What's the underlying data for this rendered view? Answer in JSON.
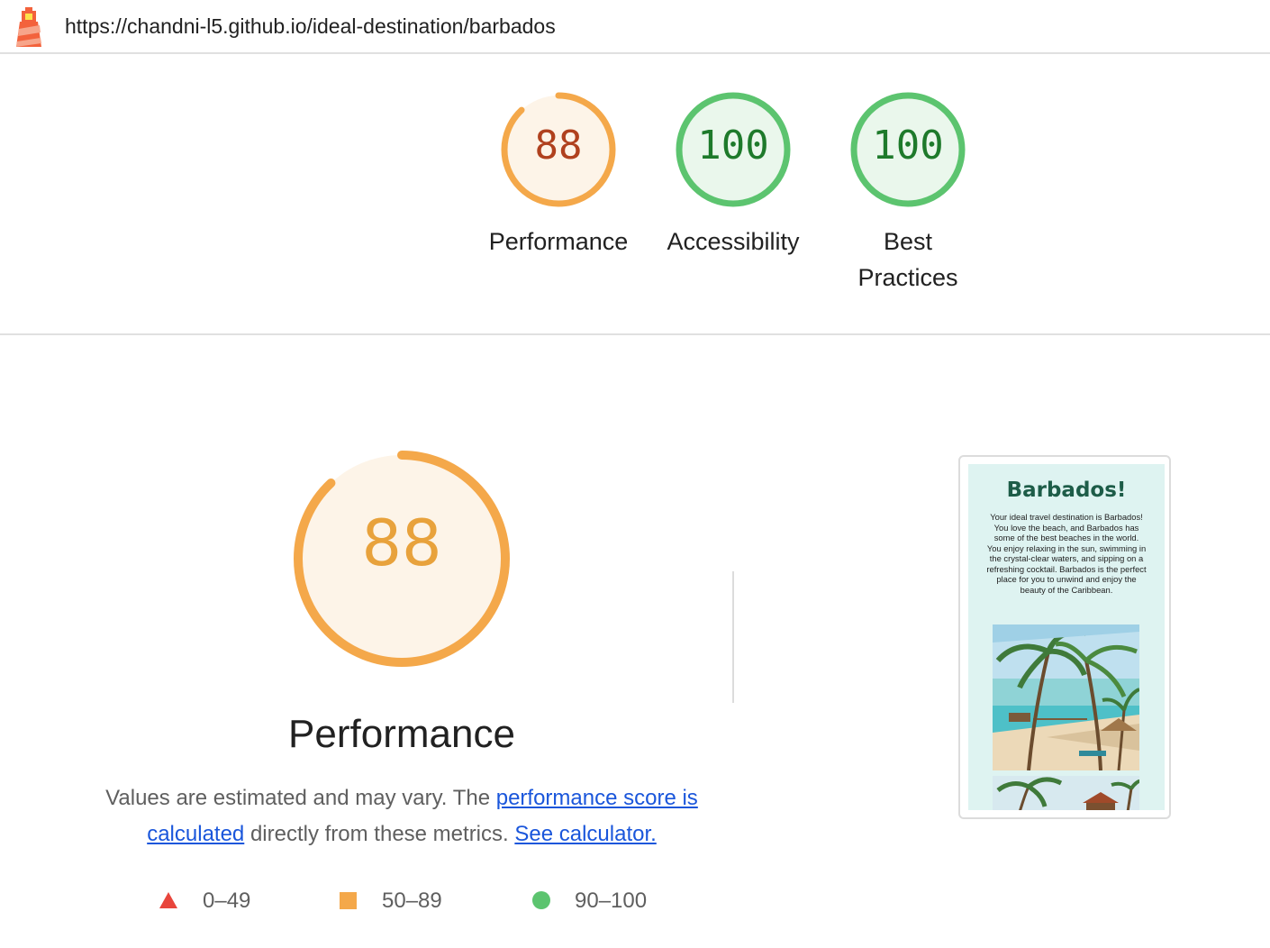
{
  "header": {
    "url": "https://chandni-l5.github.io/ideal-destination/barbados",
    "logo_icon": "lighthouse-icon"
  },
  "summary_gauges": [
    {
      "label": "Performance",
      "score": "88",
      "score_value": 88,
      "rating": "average"
    },
    {
      "label": "Accessibility",
      "score": "100",
      "score_value": 100,
      "rating": "pass"
    },
    {
      "label_line1": "Best",
      "label_line2": "Practices",
      "score": "100",
      "score_value": 100,
      "rating": "pass"
    }
  ],
  "performance": {
    "score": "88",
    "score_value": 88,
    "title": "Performance",
    "description_prefix": "Values are estimated and may vary. The ",
    "link_score": "performance score is calculated",
    "description_mid": " directly from these metrics. ",
    "link_calculator": "See calculator."
  },
  "legend": [
    {
      "range": "0–49",
      "icon": "triangle-icon",
      "color": "#e8453c"
    },
    {
      "range": "50–89",
      "icon": "square-icon",
      "color": "#f4a84a"
    },
    {
      "range": "90–100",
      "icon": "circle-icon",
      "color": "#5cc46f"
    }
  ],
  "screenshot": {
    "title": "Barbados!",
    "text": "Your ideal travel destination is Barbados! You love the beach, and Barbados has some of the best beaches in the world. You enjoy relaxing in the sun, swimming in the crystal-clear waters, and sipping on a refreshing cocktail. Barbados is the perfect place for you to unwind and enjoy the beauty of the Caribbean."
  },
  "colors": {
    "average": "#f4a84a",
    "average_text": "#b0411e",
    "pass": "#5cc46f",
    "pass_text": "#1e7a2b",
    "link": "#1a56db"
  }
}
